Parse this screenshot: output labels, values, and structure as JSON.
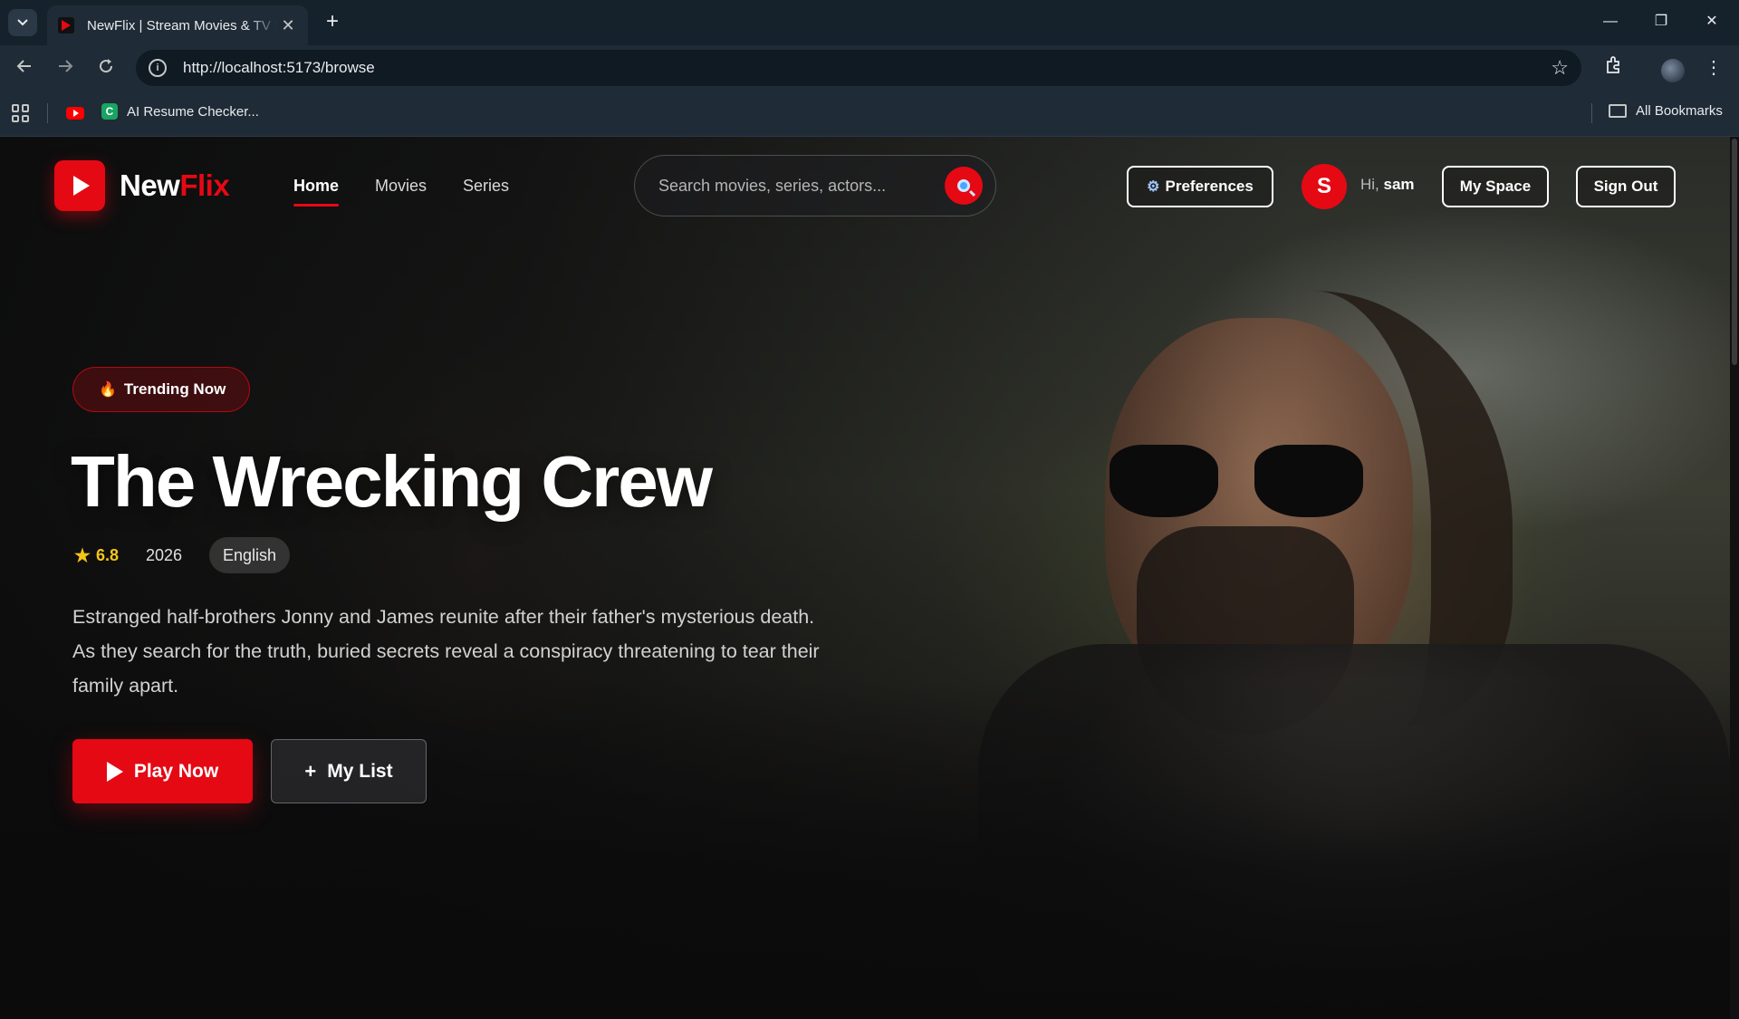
{
  "browser": {
    "tab_title": "NewFlix | Stream Movies & TV Shows",
    "url": "http://localhost:5173/browse",
    "bookmark_label": "AI Resume Checker...",
    "all_bookmarks_label": "All Bookmarks",
    "new_tab_symbol": "+",
    "close_symbol": "✕",
    "minimize_symbol": "—",
    "restore_symbol": "❐",
    "window_close_symbol": "✕"
  },
  "nav": {
    "logo_new": "New",
    "logo_flix": "Flix",
    "links": [
      "Home",
      "Movies",
      "Series"
    ],
    "active_link": "Home",
    "search_placeholder": "Search movies, series, actors...",
    "preferences_label": "Preferences",
    "avatar_initial": "S",
    "greeting_prefix": "Hi,",
    "username": "sam",
    "my_space_label": "My Space",
    "sign_out_label": "Sign Out"
  },
  "hero": {
    "badge": "Trending Now",
    "title": "The Wrecking Crew",
    "rating": "6.8",
    "year": "2026",
    "language": "English",
    "description": "Estranged half-brothers Jonny and James reunite after their father's mysterious death. As they search for the truth, buried secrets reveal a conspiracy threatening to tear their family apart.",
    "play_label": "Play Now",
    "my_list_label": "My List"
  },
  "colors": {
    "brand_red": "#e50914",
    "rating_gold": "#f5c518",
    "chrome_bg": "#1f2b36"
  },
  "icons": [
    "tab-search-icon",
    "favicon-icon",
    "back-icon",
    "forward-icon",
    "reload-icon",
    "site-info-icon",
    "bookmark-star-icon",
    "extensions-icon",
    "profile-icon",
    "menu-dots-icon",
    "apps-icon",
    "youtube-icon",
    "folder-icon",
    "play-icon",
    "search-icon",
    "gear-icon",
    "flame-icon",
    "star-icon",
    "plus-icon"
  ]
}
